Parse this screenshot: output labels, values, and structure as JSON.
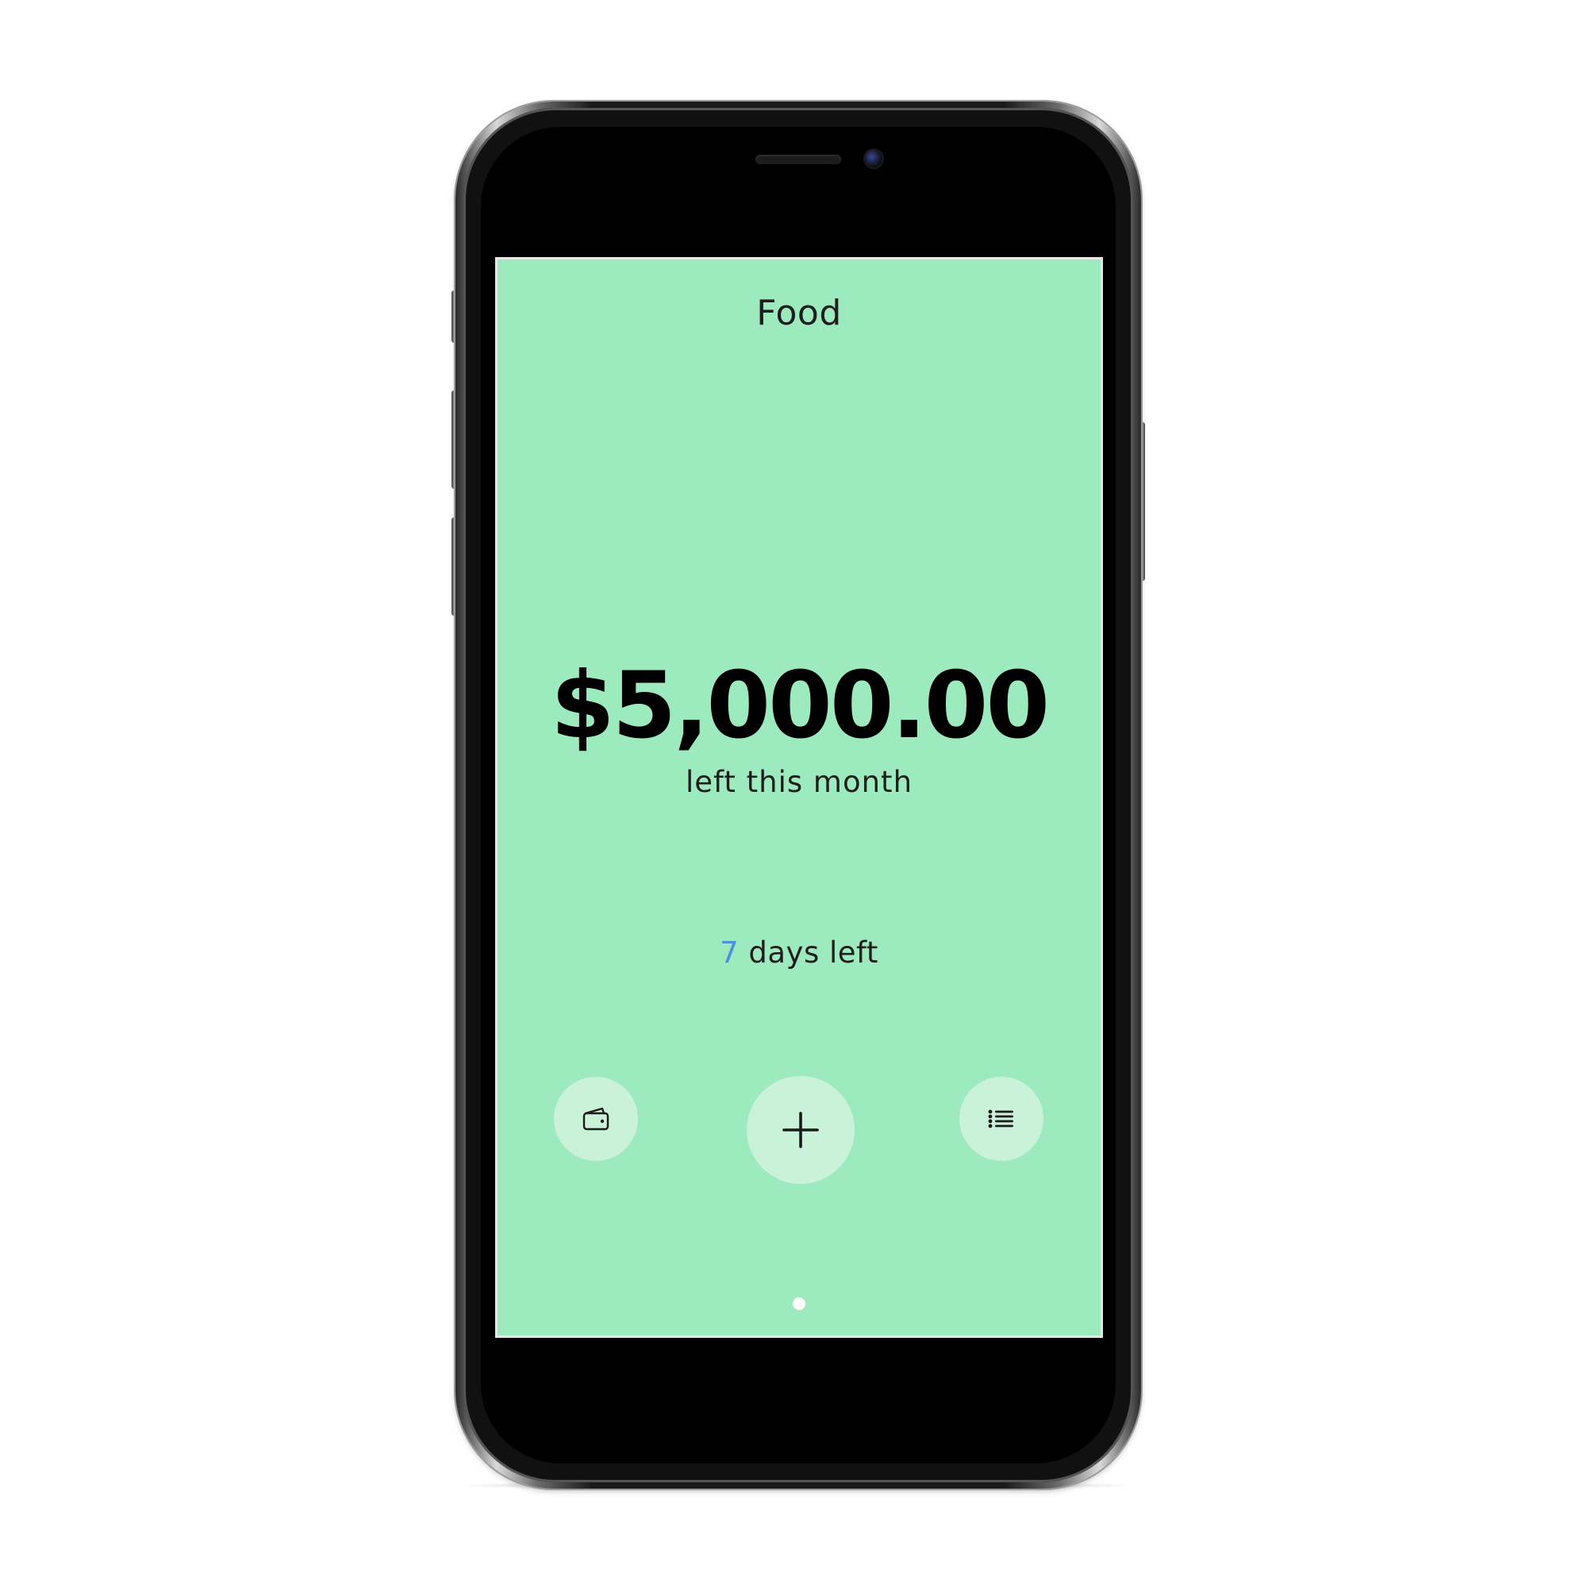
{
  "screen": {
    "title": "Food",
    "amount": "$5,000.00",
    "amount_caption": "left this month",
    "days_left_number": "7",
    "days_left_label": "days left"
  },
  "actions": {
    "wallet_icon": "wallet-icon",
    "add_icon": "plus-icon",
    "list_icon": "list-icon"
  },
  "pager": {
    "total_pages": 1,
    "current_page": 1
  },
  "colors": {
    "screen_background": "#9deabf",
    "button_background": "#c9f2d9",
    "days_number_accent": "#4a8fe0",
    "text_primary": "#000000"
  }
}
